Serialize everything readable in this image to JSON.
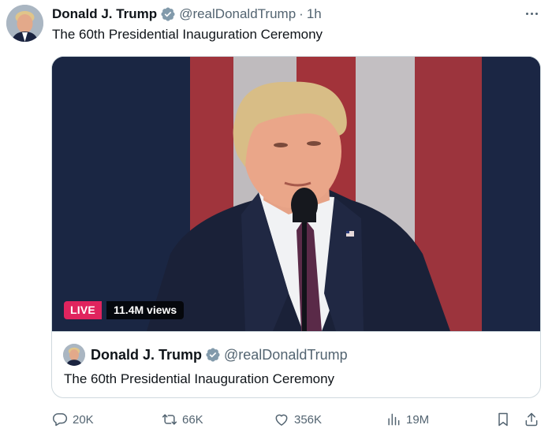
{
  "author": {
    "name": "Donald J. Trump",
    "handle": "@realDonaldTrump",
    "separator": "·",
    "time": "1h"
  },
  "tweet": {
    "text": "The 60th Presidential Inauguration Ceremony"
  },
  "media": {
    "live_label": "LIVE",
    "views": "11.4M views"
  },
  "quote": {
    "name": "Donald J. Trump",
    "handle": "@realDonaldTrump",
    "text": "The 60th Presidential Inauguration Ceremony"
  },
  "actions": {
    "replies": "20K",
    "reposts": "66K",
    "likes": "356K",
    "views": "19M"
  },
  "colors": {
    "verified": "#1d9bf0",
    "live": "#e0245e",
    "text_secondary": "#536471"
  },
  "icons": [
    "more-icon",
    "verified-icon",
    "reply-icon",
    "repost-icon",
    "like-icon",
    "views-icon",
    "bookmark-icon",
    "share-icon"
  ]
}
